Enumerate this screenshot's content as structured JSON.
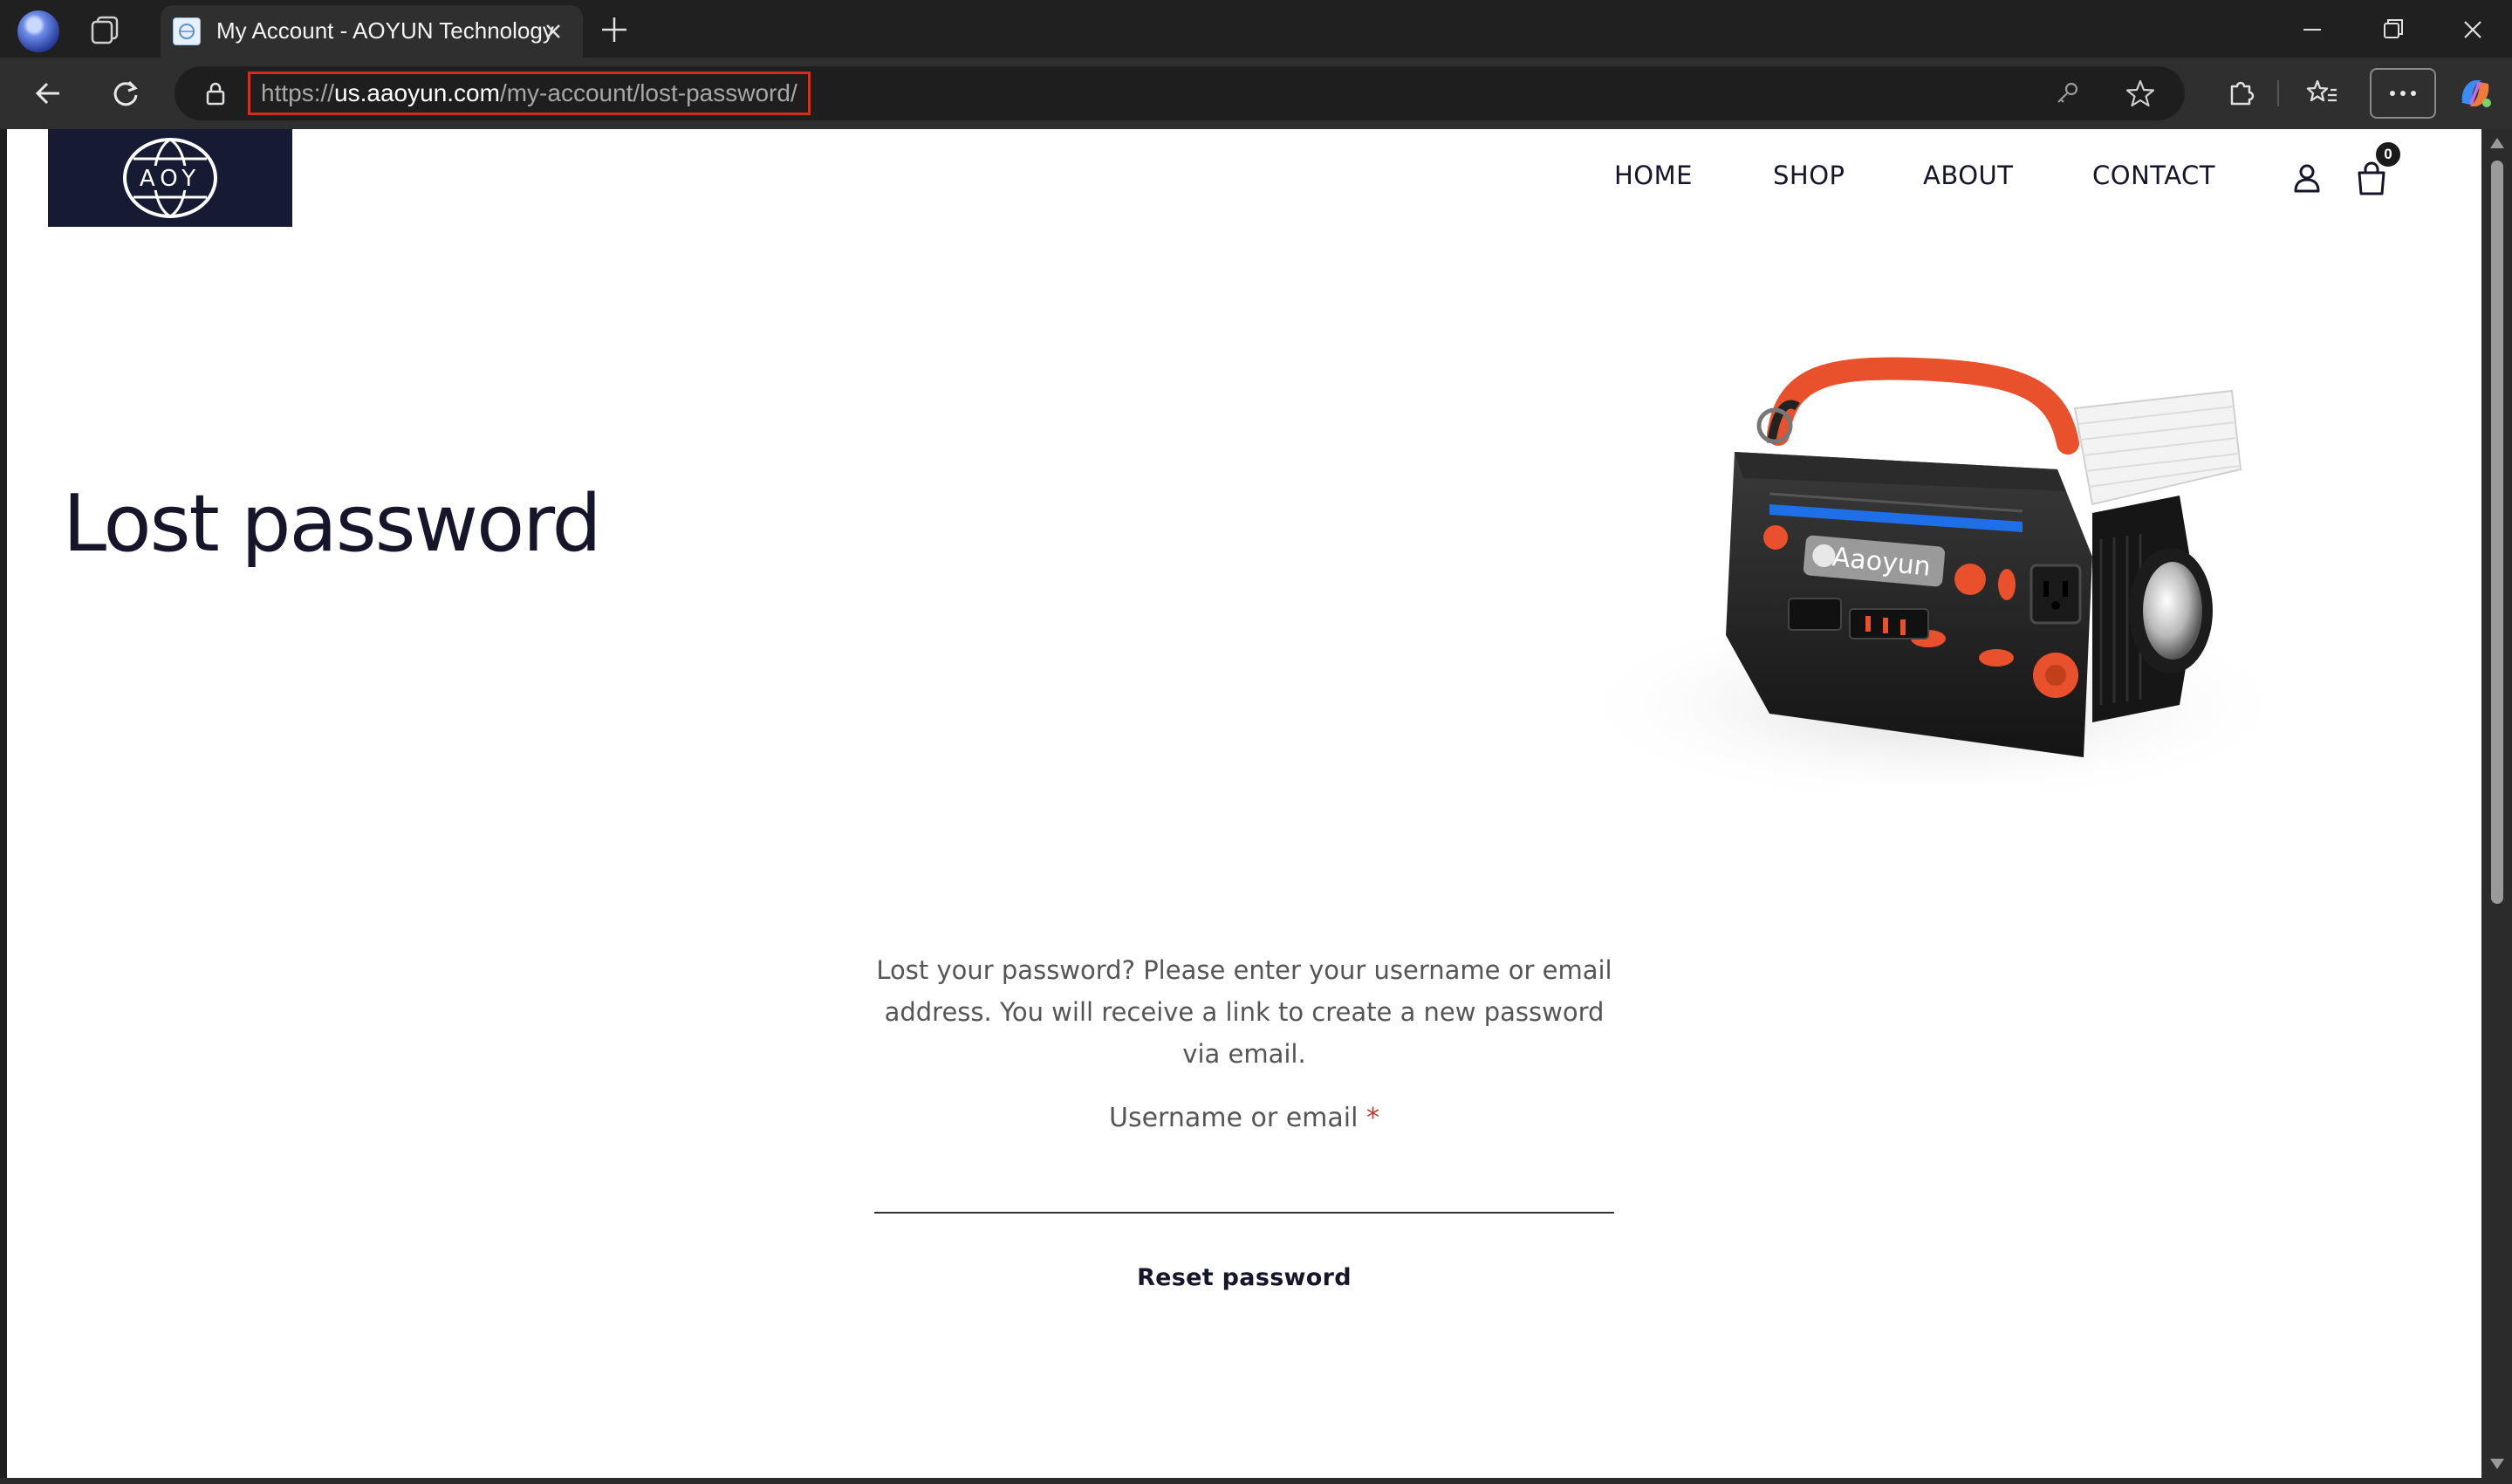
{
  "browser": {
    "tab": {
      "title": "My Account - AOYUN Technology"
    },
    "address": {
      "scheme": "https://",
      "host": "us.aaoyun.com",
      "path": "/my-account/lost-password/"
    }
  },
  "site": {
    "logo_text": "AOY",
    "nav": {
      "home": "HOME",
      "shop": "SHOP",
      "about": "ABOUT",
      "contact": "CONTACT"
    },
    "cart_count": "0"
  },
  "page": {
    "title": "Lost password",
    "hero_brand": "Aaoyun",
    "intro": "Lost your password? Please enter your username or email address. You will receive a link to create a new password via email.",
    "field_label": "Username or email",
    "required_mark": "*",
    "input_value": "",
    "reset_label": "Reset password"
  },
  "colors": {
    "header_bg": "#161a33",
    "accent_orange": "#e8512b",
    "required": "#c0392b",
    "url_highlight": "#d2301e"
  }
}
